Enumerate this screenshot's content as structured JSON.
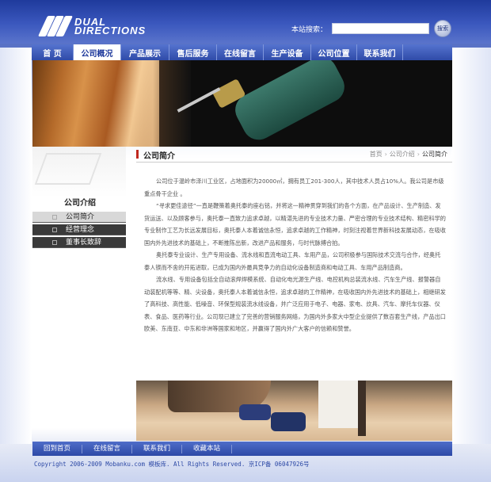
{
  "header": {
    "logo_line1": "DUAL",
    "logo_line2": "DIRECTIONS",
    "search_label": "本站搜索：",
    "search_value": "",
    "search_button": "搜索"
  },
  "nav": {
    "items": [
      {
        "label": "首 页"
      },
      {
        "label": "公司概况"
      },
      {
        "label": "产品展示"
      },
      {
        "label": "售后服务"
      },
      {
        "label": "在线留言"
      },
      {
        "label": "生产设备"
      },
      {
        "label": "公司位置"
      },
      {
        "label": "联系我们"
      }
    ],
    "active_index": 1
  },
  "sidebar": {
    "title": "公司介绍",
    "items": [
      {
        "label": "公司简介"
      },
      {
        "label": "经营理念"
      },
      {
        "label": "董事长致辞"
      }
    ],
    "active_index": 0
  },
  "main": {
    "title": "公司简介",
    "breadcrumb": [
      "首页",
      "公司介绍",
      "公司简介"
    ],
    "paragraphs": [
      "公司位于温岭市泽川工业区，占地面积为20000㎡，拥有员工201-300人，其中技术人员占10%人。我公司是市级重点骨干企业 。",
      "“寻求更佳途径”一直是鞭策着奥托泰的座右铭，并将这一精神贯穿到我们的各个方面，在产品设计、生产制造、发货运送、以及顾客参与，奥托泰一直致力追求卓越，以精湛先进的专业技术力量、严密合理的专业技术结构、精密科学的专业制作工艺为长远发展目标，奥托泰人本着诚信永恒，追求卓越的工作精神，时刻注视着世界新科技发展动态，在吸收国内外先进技术的基础上，不断推陈出新，改进产品和服务，与时代脉搏合拍。",
      "奥托泰专业设计、生产专用设备、流水线和直流电动工具、车用产品，公司积极参与国际技术交流与合作，经奥托泰人锲而不舍的开拓进取，已成为国内外最具竞争力的自动化设备制造商和电动工具、车用产品制造商。",
      "流水线、专用设备包括全自动滚焊焊模系统、自动化电光源生产线、电控机构总装流水线、汽车生产线、报警器自动装配机等等、精、尖设备，奥托泰人本着诚信永恒，追求卓越的工作精神，在吸收国内外先进技术的基础上，相继研发了高科技、高性能、低噪音、环保型规装流水线设备，并广泛应用于电子、电器、家电、炊具、汽车、摩托车仪器、仪表、食品、医药等行业。公司现已建立了完善的营销服务网络，为国内外多家大中型企业提供了数百套生产线，产品出口欧美、东南亚、中东和非洲等国家和地区，并赢得了国内外广大客户的信赖和赞誉。"
    ]
  },
  "footer": {
    "links": [
      {
        "label": "回到首页"
      },
      {
        "label": "在线留言"
      },
      {
        "label": "联系我们"
      },
      {
        "label": "收藏本站"
      }
    ],
    "copyright": "Copyright 2006-2009 Mobanku.com 模板库. All Rights Reserved. 京ICP备 06047926号"
  },
  "colors": {
    "brand_blue": "#2f4ba8",
    "accent_red": "#c0281f"
  }
}
